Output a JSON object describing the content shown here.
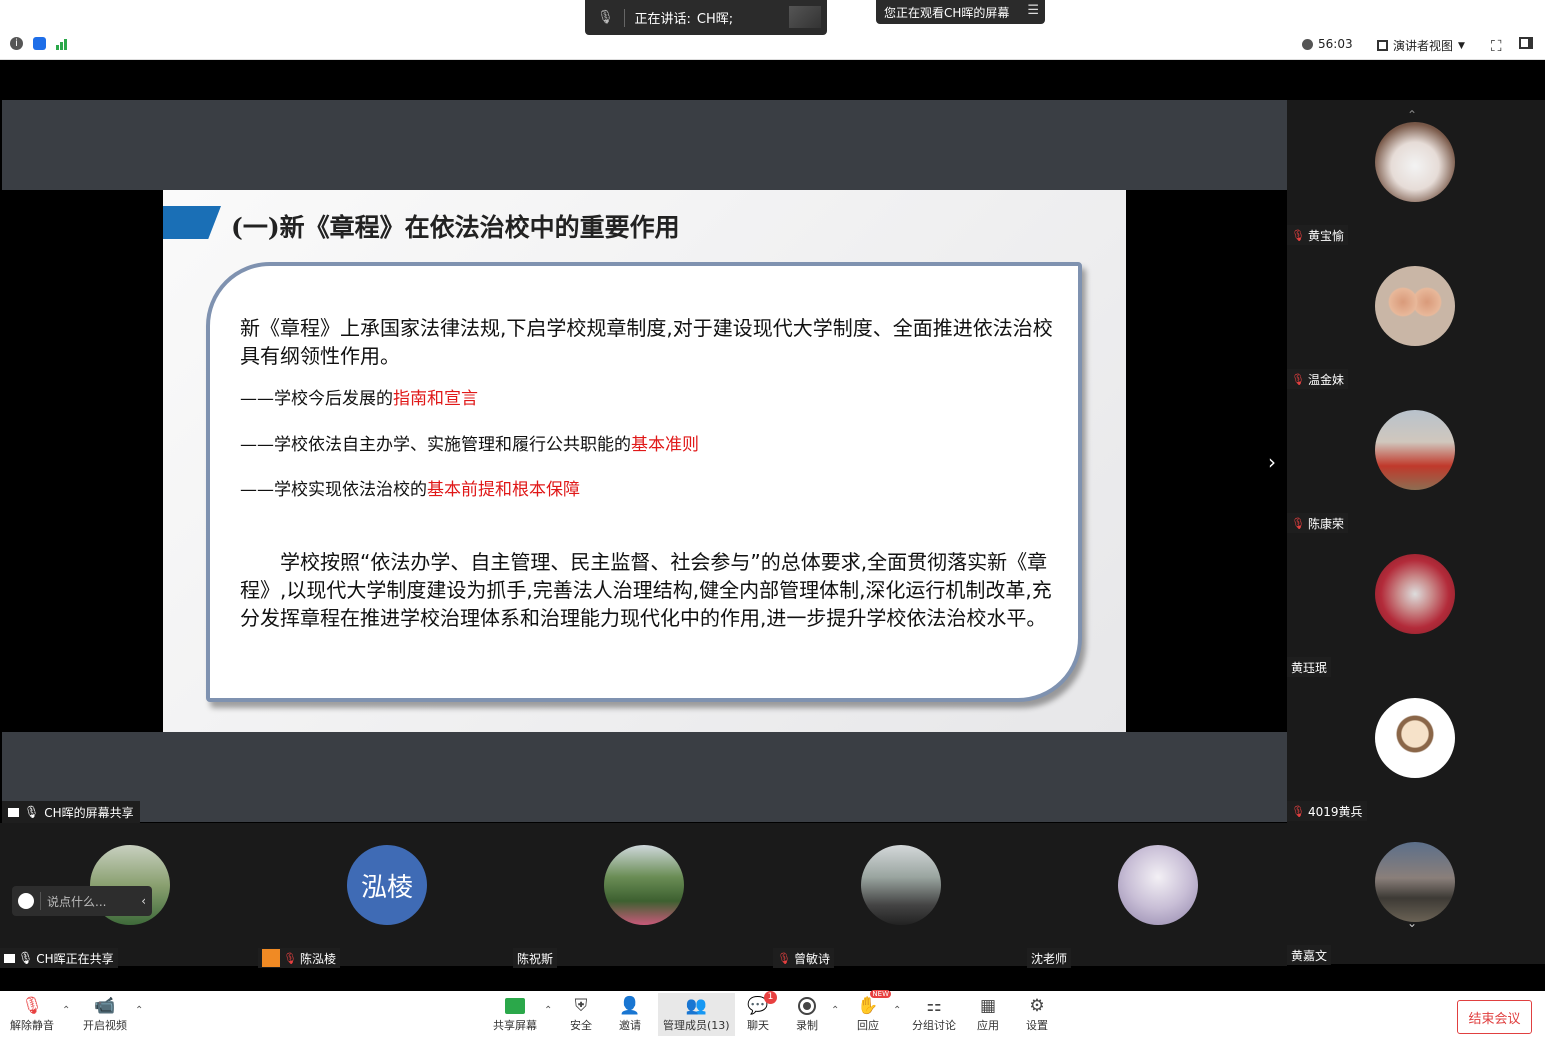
{
  "top": {
    "speaking_label": "正在讲话:",
    "speaking_name": "CH晖;",
    "viewing_text": "您正在观看CH晖的屏幕",
    "timer": "56:03",
    "view_mode": "演讲者视图"
  },
  "share": {
    "label": "CH晖的屏幕共享"
  },
  "slide": {
    "title": "(一)新《章程》在依法治校中的重要作用",
    "intro": "新《章程》上承国家法律法规,下启学校规章制度,对于建设现代大学制度、全面推进依法治校具有纲领性作用。",
    "bullets": [
      {
        "prefix": "——学校今后发展的",
        "highlight": "指南和宣言"
      },
      {
        "prefix": "——学校依法自主办学、实施管理和履行公共职能的",
        "highlight": "基本准则"
      },
      {
        "prefix": "——学校实现依法治校的",
        "highlight": "基本前提和根本保障"
      }
    ],
    "closing": "学校按照“依法办学、自主管理、民主监督、社会参与”的总体要求,全面贯彻落实新《章程》,以现代大学制度建设为抓手,完善法人治理结构,健全内部管理体制,深化运行机制改革,充分发挥章程在推进学校治理体系和治理能力现代化中的作用,进一步提升学校依法治校水平。"
  },
  "participants_right": [
    {
      "name": "黄宝愉",
      "muted": true
    },
    {
      "name": "温金妹",
      "muted": true
    },
    {
      "name": "陈康荣",
      "muted": true
    },
    {
      "name": "黄珏珉",
      "muted": false
    },
    {
      "name": "4019黄兵",
      "muted": true
    },
    {
      "name": "黄嘉文",
      "muted": false
    }
  ],
  "participants_bottom": [
    {
      "name": "CH晖正在共享",
      "muted": false
    },
    {
      "name": "陈泓棱",
      "muted": true,
      "avatar_text": "泓棱"
    },
    {
      "name": "陈祝斯",
      "muted": false
    },
    {
      "name": "曾敏诗",
      "muted": true
    },
    {
      "name": "沈老师",
      "muted": false
    }
  ],
  "chat": {
    "placeholder": "说点什么..."
  },
  "toolbar": {
    "unmute": "解除静音",
    "start_video": "开启视频",
    "share_screen": "共享屏幕",
    "security": "安全",
    "invite": "邀请",
    "participants": "管理成员(13)",
    "chat": "聊天",
    "chat_badge": "1",
    "record": "录制",
    "reactions": "回应",
    "reactions_badge": "NEW",
    "breakout": "分组讨论",
    "apps": "应用",
    "settings": "设置",
    "end_meeting": "结束会议"
  },
  "colors": {
    "accent_blue": "#1a6fb6",
    "highlight_red": "#e01818",
    "end_red": "#e04040"
  }
}
